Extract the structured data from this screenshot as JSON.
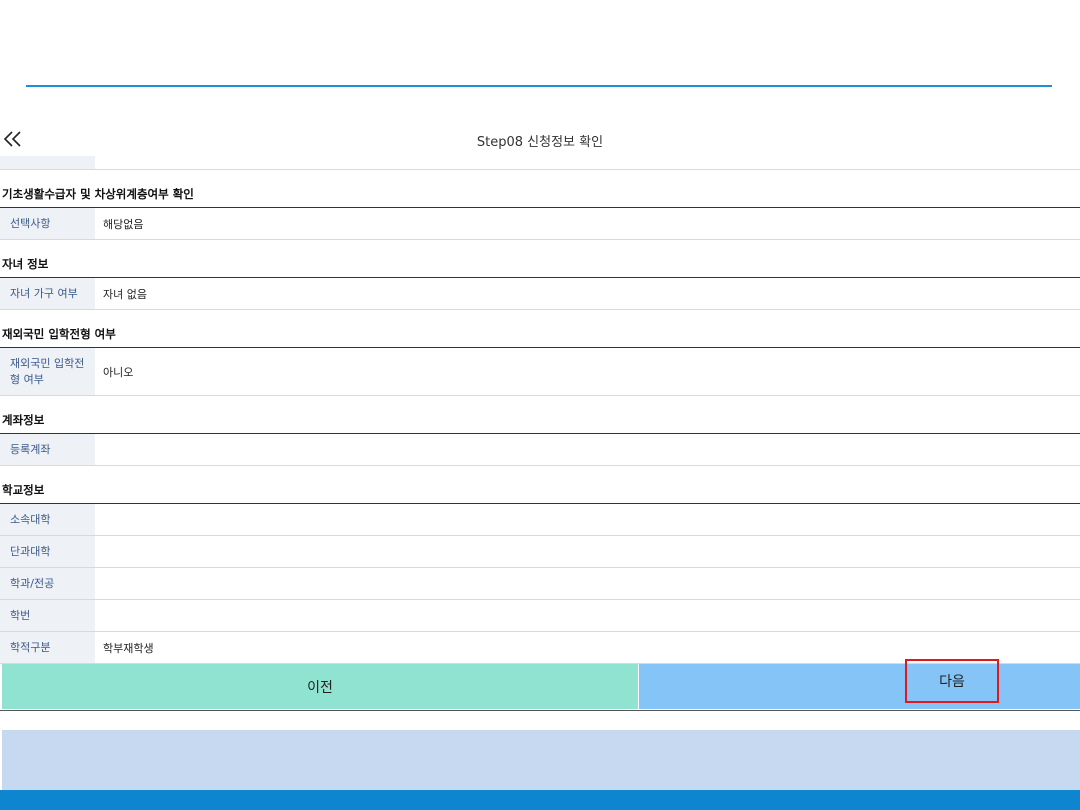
{
  "header": {
    "step_title": "Step08 신청정보 확인",
    "back_icon": "double-chevron-left-icon"
  },
  "sections": {
    "basic_living": {
      "title": "기초생활수급자 및 차상위계층여부 확인",
      "rows": [
        {
          "label": "선택사항",
          "value": "해당없음"
        }
      ]
    },
    "children": {
      "title": "자녀 정보",
      "rows": [
        {
          "label": "자녀 가구 여부",
          "value": "자녀 없음"
        }
      ]
    },
    "overseas": {
      "title": "재외국민 입학전형 여부",
      "rows": [
        {
          "label": "재외국민 입학전형 여부",
          "value": "아니오"
        }
      ]
    },
    "account": {
      "title": "계좌정보",
      "rows": [
        {
          "label": "등록계좌",
          "value": ""
        }
      ]
    },
    "school": {
      "title": "학교정보",
      "rows": [
        {
          "label": "소속대학",
          "value": ""
        },
        {
          "label": "단과대학",
          "value": ""
        },
        {
          "label": "학과/전공",
          "value": ""
        },
        {
          "label": "학번",
          "value": ""
        },
        {
          "label": "학적구분",
          "value": "학부재학생"
        }
      ]
    }
  },
  "buttons": {
    "prev_label": "이전",
    "next_label": "다음"
  },
  "colors": {
    "accent_blue": "#1e8ed8",
    "prev_bg": "#90e3d1",
    "next_bg": "#84c4f6",
    "highlight_border": "#e0191e",
    "footer_blue": "#0d86cf",
    "band": "#c6d9f1"
  }
}
